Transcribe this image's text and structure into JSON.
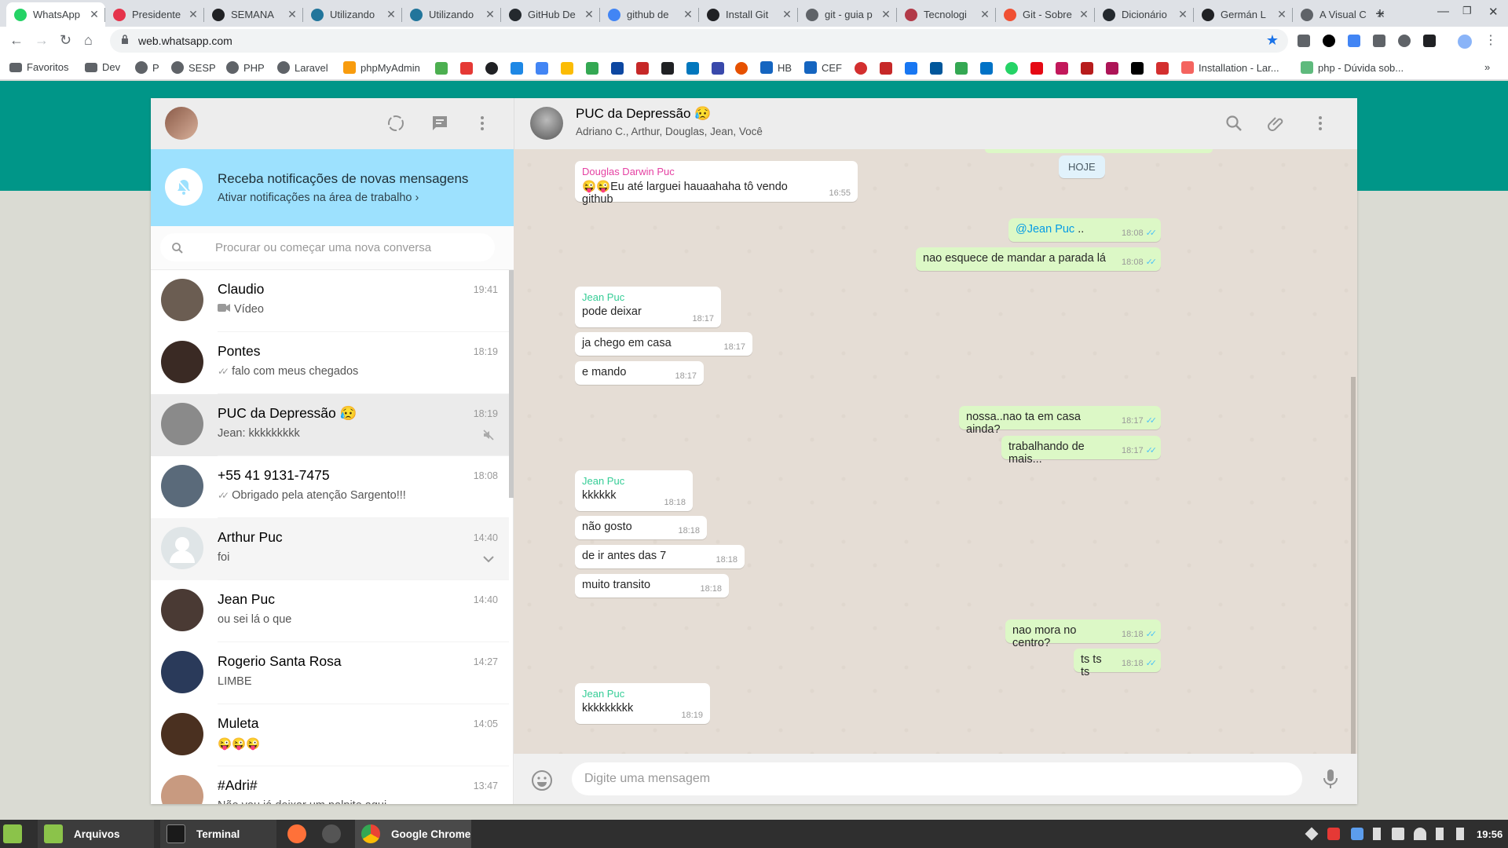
{
  "browser": {
    "tabs": [
      {
        "label": "WhatsApp",
        "color": "#25d366"
      },
      {
        "label": "Presidente",
        "color": "#e5334b"
      },
      {
        "label": "SEMANA",
        "color": "#202124"
      },
      {
        "label": "Utilizando",
        "color": "#21759b"
      },
      {
        "label": "Utilizando",
        "color": "#21759b"
      },
      {
        "label": "GitHub De",
        "color": "#24292e"
      },
      {
        "label": "github de",
        "color": "#4285f4"
      },
      {
        "label": "Install Git",
        "color": "#202124"
      },
      {
        "label": "git - guia p",
        "color": "#5f6368"
      },
      {
        "label": "Tecnologi",
        "color": "#b23a48"
      },
      {
        "label": "Git - Sobre",
        "color": "#f05033"
      },
      {
        "label": "Dicionário",
        "color": "#24292e"
      },
      {
        "label": "Germán L",
        "color": "#202124"
      },
      {
        "label": "A Visual C",
        "color": "#5f6368"
      }
    ],
    "new_tab": "+",
    "url": "web.whatsapp.com",
    "bookmarks": [
      {
        "label": "Favoritos"
      },
      {
        "label": "Dev"
      },
      {
        "label": "P"
      },
      {
        "label": "SESP"
      },
      {
        "label": "PHP"
      },
      {
        "label": "Laravel"
      },
      {
        "label": "phpMyAdmin"
      },
      {
        "label": "HB"
      },
      {
        "label": "CEF"
      },
      {
        "label": "Installation - Lar..."
      },
      {
        "label": "php - Dúvida sob..."
      }
    ],
    "more_bookmarks": "»"
  },
  "sidebar": {
    "notification": {
      "title": "Receba notificações de novas mensagens",
      "subtitle": "Ativar notificações na área de trabalho ›"
    },
    "search_placeholder": "Procurar ou começar uma nova conversa",
    "chats": [
      {
        "name": "Claudio",
        "time": "19:41",
        "preview": "Vídeo",
        "avatar": "#6b5d52"
      },
      {
        "name": "Pontes",
        "time": "18:19",
        "preview": "falo com meus chegados",
        "avatar": "#3a2a24"
      },
      {
        "name": "PUC da Depressão 😥",
        "time": "18:19",
        "preview": "Jean: kkkkkkkkk",
        "avatar": "#8a8a8a"
      },
      {
        "name": "+55 41 9131-7475",
        "time": "18:08",
        "preview": "Obrigado pela atenção Sargento!!!",
        "avatar": "#5a6a7a"
      },
      {
        "name": "Arthur Puc",
        "time": "14:40",
        "preview": "foi",
        "avatar": "#dfe5e7"
      },
      {
        "name": "Jean Puc",
        "time": "14:40",
        "preview": "ou sei lá o que",
        "avatar": "#4a3a34"
      },
      {
        "name": "Rogerio Santa Rosa",
        "time": "14:27",
        "preview": "LIMBE",
        "avatar": "#2a3a5a"
      },
      {
        "name": "Muleta",
        "time": "14:05",
        "preview": "😜😜😜",
        "avatar": "#4a3020"
      },
      {
        "name": "#Adri#",
        "time": "13:47",
        "preview": "Não vou já deixar um palpite aqui",
        "avatar": "#c89a80"
      }
    ]
  },
  "conversation": {
    "name": "PUC da Depressão 😥",
    "members": "Adriano C., Arthur, Douglas, Jean, Você",
    "day_badge": "HOJE",
    "messages": [
      {
        "dir": "in",
        "sender": "Douglas Darwin Puc",
        "text": "😜😜Eu até larguei hauaahaha tô vendo github",
        "time": "16:55"
      },
      {
        "dir": "out",
        "mention": "@Jean Puc",
        "text": " ..",
        "time": "18:08"
      },
      {
        "dir": "out",
        "text": "nao esquece de mandar a parada lá",
        "time": "18:08"
      },
      {
        "dir": "in",
        "sender": "Jean Puc",
        "text": "pode deixar",
        "time": "18:17"
      },
      {
        "dir": "in",
        "text": "ja chego em casa",
        "time": "18:17"
      },
      {
        "dir": "in",
        "text": "e mando",
        "time": "18:17"
      },
      {
        "dir": "out",
        "text": "nossa..nao ta em casa ainda?",
        "time": "18:17"
      },
      {
        "dir": "out",
        "text": "trabalhando de mais...",
        "time": "18:17"
      },
      {
        "dir": "in",
        "sender": "Jean Puc",
        "text": "kkkkkk",
        "time": "18:18"
      },
      {
        "dir": "in",
        "text": "não gosto",
        "time": "18:18"
      },
      {
        "dir": "in",
        "text": "de ir antes das 7",
        "time": "18:18"
      },
      {
        "dir": "in",
        "text": "muito transito",
        "time": "18:18"
      },
      {
        "dir": "out",
        "text": "nao mora no centro?",
        "time": "18:18"
      },
      {
        "dir": "out",
        "text": "ts ts ts",
        "time": "18:18"
      },
      {
        "dir": "in",
        "sender": "Jean Puc",
        "text": "kkkkkkkkk",
        "time": "18:19"
      }
    ],
    "input_placeholder": "Digite uma mensagem"
  },
  "taskbar": {
    "apps": [
      {
        "label": "Arquivos"
      },
      {
        "label": "Terminal"
      },
      {
        "label": "Google Chrome"
      }
    ],
    "clock": "19:56"
  },
  "colors": {
    "teal": "#009688",
    "bubble_out": "#dcf8c6",
    "mention": "#039be5",
    "douglas": "#e542a3",
    "jean": "#35cd96"
  }
}
